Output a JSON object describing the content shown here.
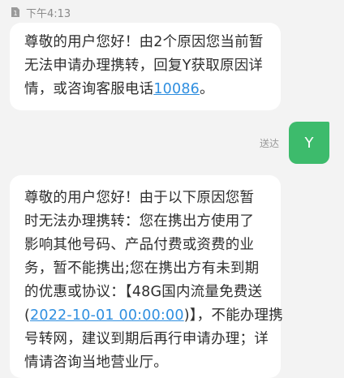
{
  "header": {
    "sim_label": "1",
    "timestamp": "下午4:13"
  },
  "messages": {
    "incoming_1": {
      "lines": [
        "尊敬的用户您好！由2个原因您当前暂",
        "无法申请办理携转，回复Y获取原因详"
      ],
      "line3_prefix": "情，或咨询客服电话",
      "phone_link": "10086",
      "line3_suffix": "。"
    },
    "outgoing_1": {
      "status": "送达",
      "text": "Y"
    },
    "incoming_2": {
      "lines": [
        "尊敬的用户您好！由于以下原因您暂",
        "时无法办理携转：您在携出方使用了",
        "影响其他号码、产品付费或资费的业",
        "务，暂不能携出;您在携出方有未到期",
        "的优惠或协议：【48G国内流量免费送"
      ],
      "line6_prefix": "(",
      "date_link": "2022-10-01 00:00:00",
      "line6_suffix": ")】，不能办理携",
      "tail_lines": [
        "号转网，建议到期后再行申请办理；详",
        "情请咨询当地营业厅。"
      ]
    }
  },
  "colors": {
    "background": "#f3f3f3",
    "bubble": "#ffffff",
    "sent_bubble": "#3dbb6c",
    "link": "#2f8fe0"
  },
  "icons": {
    "sim": "sim-card-icon"
  }
}
